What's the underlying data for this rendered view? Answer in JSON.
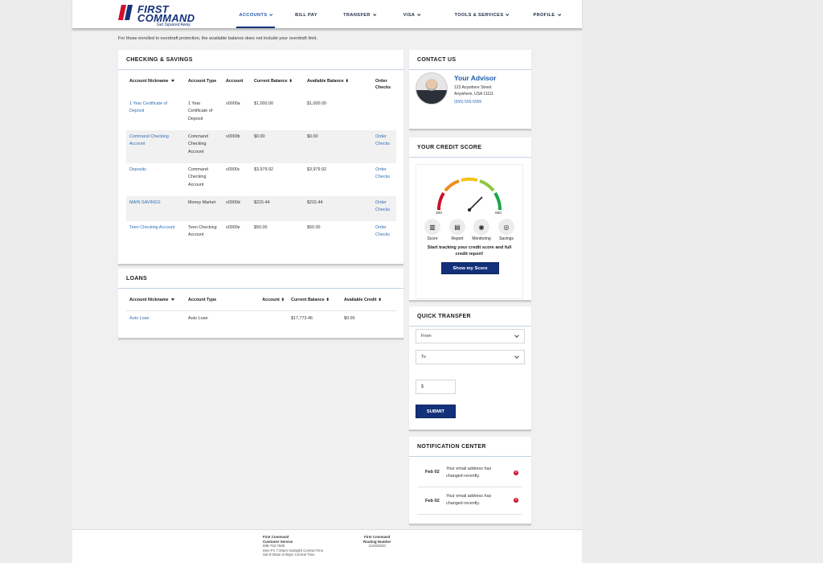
{
  "brand": {
    "line1": "FIRST",
    "line2": "COMMAND",
    "tagline": "Get Squared Away",
    "primary_color": "#13317a",
    "accent_color": "#d0102b",
    "link_color": "#2f6db5"
  },
  "nav": [
    {
      "label": "ACCOUNTS",
      "caret": true,
      "active": true
    },
    {
      "label": "BILL PAY",
      "caret": false,
      "active": false
    },
    {
      "label": "TRANSFER",
      "caret": true,
      "active": false
    },
    {
      "label": "VISA",
      "caret": true,
      "active": false
    },
    {
      "label": "TOOLS & SERVICES",
      "caret": true,
      "active": false
    },
    {
      "label": "PROFILE",
      "caret": true,
      "active": false
    }
  ],
  "notice": "For those enrolled in overdraft protection, the available balance does not include your overdraft limit.",
  "checking": {
    "title": "CHECKING & SAVINGS",
    "headers": {
      "nickname": "Account Nickname",
      "type": "Account Type",
      "account": "Account",
      "current": "Current Balance",
      "available": "Available Balance",
      "order": "Order Checks"
    },
    "rows": [
      {
        "nickname": "1 Year Certificate of Deposit",
        "type": "1 Year Certificate of Deposit",
        "account": "x0000a",
        "current": "$1,000.00",
        "available": "$1,000.00",
        "order": ""
      },
      {
        "nickname": "Command Checking Account",
        "type": "Command Checking Account",
        "account": "x0000b",
        "current": "$0.00",
        "available": "$0.00",
        "order": "Order Checks"
      },
      {
        "nickname": "Deposits",
        "type": "Command Checking Account",
        "account": "x0000c",
        "current": "$3,979.92",
        "available": "$3,979.92",
        "order": "Order Checks"
      },
      {
        "nickname": "MAIN SAVINGS",
        "type": "Money Market",
        "account": "x0000d",
        "current": "$215.44",
        "available": "$215.44",
        "order": "Order Checks"
      },
      {
        "nickname": "Teen Checking Account",
        "type": "Teen Checking Account",
        "account": "x0000e",
        "current": "$50.00",
        "available": "$50.00",
        "order": "Order Checks"
      }
    ]
  },
  "loans": {
    "title": "LOANS",
    "headers": {
      "nickname": "Account Nickname",
      "type": "Account Type",
      "account": "Account",
      "current": "Current Balance",
      "available": "Available Credit"
    },
    "rows": [
      {
        "nickname": "Auto Loan",
        "type": "Auto Loan",
        "account": "",
        "current": "$17,773.46",
        "available": "$0.00"
      }
    ]
  },
  "contact": {
    "title": "CONTACT US",
    "advisor_name": "Your Advisor",
    "address1": "123 Anywhere Street",
    "address2": "Anywhere, USA 11111",
    "phone": "(555) 555-5555"
  },
  "credit": {
    "title": "YOUR CREDIT SCORE",
    "min_label": "300",
    "max_label": "850",
    "icons": [
      {
        "icon": "bar-chart-icon",
        "glyph": "▥",
        "label": "Score"
      },
      {
        "icon": "report-icon",
        "glyph": "▤",
        "label": "Report"
      },
      {
        "icon": "monitoring-icon",
        "glyph": "◉",
        "label": "Monitoring"
      },
      {
        "icon": "savings-icon",
        "glyph": "◎",
        "label": "Savings"
      }
    ],
    "message": "Start tracking your credit score and full credit report!",
    "button": "Show my Score",
    "gauge_colors": [
      "#d0102b",
      "#f08a1c",
      "#f2c418",
      "#8cc63f",
      "#1aa64b"
    ]
  },
  "transfer": {
    "title": "QUICK TRANSFER",
    "from": "From",
    "to": "To",
    "amount": "$",
    "submit": "SUBMIT"
  },
  "notifications": {
    "title": "NOTIFICATION CENTER",
    "items": [
      {
        "date": "Feb 02",
        "message": "Your email address has changed recently."
      },
      {
        "date": "Feb 02",
        "message": "Your email address has changed recently."
      }
    ]
  },
  "footer": {
    "cs_title1": "First Command",
    "cs_title2": "Customer Service",
    "cs_phone": "888-763-7600",
    "cs_hours1": "Mon-Fri 7:30am-midnight Central Time",
    "cs_hours2": "Sat 9:00am-3:00pm Central Time",
    "rt_title1": "First Command",
    "rt_title2": "Routing Number",
    "rt_number": "111925933"
  }
}
